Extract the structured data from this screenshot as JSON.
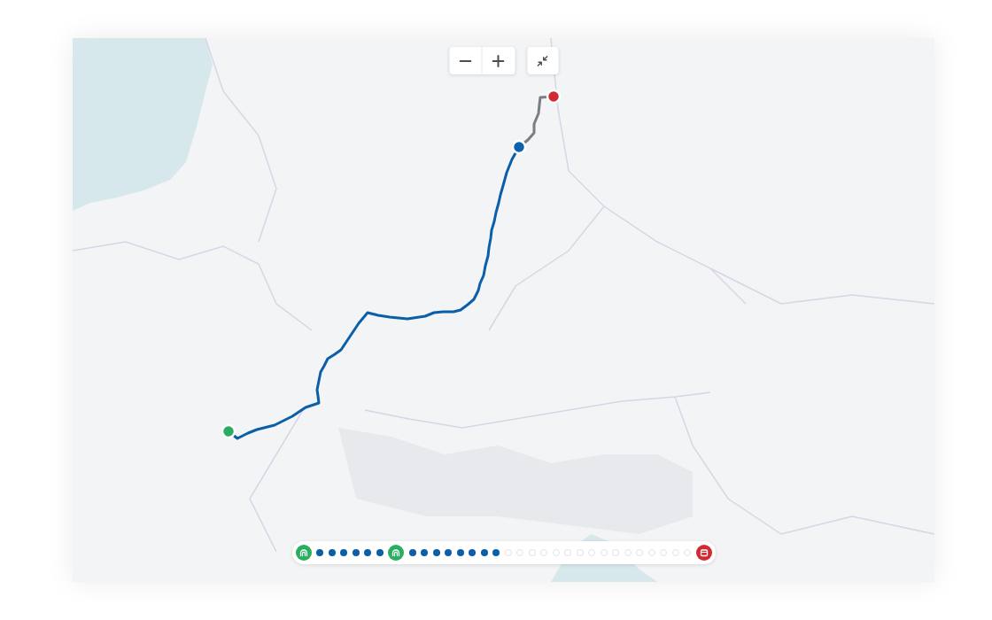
{
  "map": {
    "markers": [
      {
        "kind": "start",
        "color": "#27ae5f"
      },
      {
        "kind": "current",
        "color": "#0b62ad"
      },
      {
        "kind": "end",
        "color": "#d12a32"
      }
    ]
  },
  "progress": {
    "stops": [
      {
        "kind": "waypoint",
        "color": "#27ae5f"
      },
      {
        "kind": "dot",
        "completed": true
      },
      {
        "kind": "dot",
        "completed": true
      },
      {
        "kind": "dot",
        "completed": true
      },
      {
        "kind": "dot",
        "completed": true
      },
      {
        "kind": "dot",
        "completed": true
      },
      {
        "kind": "dot",
        "completed": true
      },
      {
        "kind": "waypoint",
        "color": "#27ae5f"
      },
      {
        "kind": "dot",
        "completed": true
      },
      {
        "kind": "dot",
        "completed": true
      },
      {
        "kind": "dot",
        "completed": true
      },
      {
        "kind": "dot",
        "completed": true
      },
      {
        "kind": "dot",
        "completed": true
      },
      {
        "kind": "dot",
        "completed": true
      },
      {
        "kind": "dot",
        "completed": true
      },
      {
        "kind": "dot",
        "completed": true
      },
      {
        "kind": "dot",
        "completed": false
      },
      {
        "kind": "dot",
        "completed": false
      },
      {
        "kind": "dot",
        "completed": false
      },
      {
        "kind": "dot",
        "completed": false
      },
      {
        "kind": "dot",
        "completed": false
      },
      {
        "kind": "dot",
        "completed": false
      },
      {
        "kind": "dot",
        "completed": false
      },
      {
        "kind": "dot",
        "completed": false
      },
      {
        "kind": "dot",
        "completed": false
      },
      {
        "kind": "dot",
        "completed": false
      },
      {
        "kind": "dot",
        "completed": false
      },
      {
        "kind": "dot",
        "completed": false
      },
      {
        "kind": "dot",
        "completed": false
      },
      {
        "kind": "dot",
        "completed": false
      },
      {
        "kind": "dot",
        "completed": false
      },
      {
        "kind": "dot",
        "completed": false
      },
      {
        "kind": "destination",
        "color": "#d12a32"
      }
    ]
  }
}
